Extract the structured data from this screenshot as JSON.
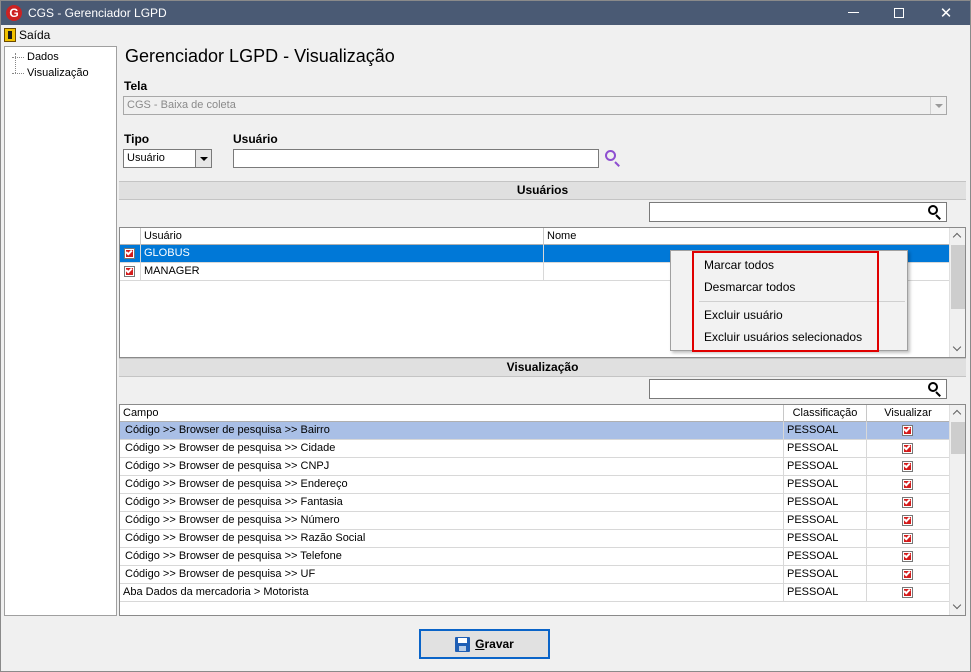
{
  "window": {
    "title": "CGS - Gerenciador LGPD",
    "logo_letter": "G",
    "controls": {
      "minimize": "minimize-icon",
      "maximize": "maximize-icon",
      "close_glyph": "✕"
    }
  },
  "menu": {
    "exit_label": "Saída"
  },
  "tree": {
    "items": [
      "Dados",
      "Visualização"
    ]
  },
  "page": {
    "title": "Gerenciador LGPD - Visualização",
    "tela_label": "Tela",
    "tela_value": "CGS - Baixa de coleta",
    "tipo_label": "Tipo",
    "tipo_value": "Usuário",
    "usuario_label": "Usuário",
    "usuario_value": ""
  },
  "users_section": {
    "header": "Usuários",
    "filter_value": "",
    "columns": [
      "Usuário",
      "Nome"
    ],
    "rows": [
      {
        "usuario": "GLOBUS",
        "nome": "",
        "checked": true,
        "selected": true
      },
      {
        "usuario": "MANAGER",
        "nome": "",
        "checked": true,
        "selected": false
      }
    ]
  },
  "context_menu": {
    "items": [
      "Marcar todos",
      "Desmarcar todos",
      "Excluir usuário",
      "Excluir usuários selecionados"
    ]
  },
  "viz_section": {
    "header": "Visualização",
    "filter_value": "",
    "columns": [
      "Campo",
      "Classificação",
      "Visualizar"
    ],
    "rows": [
      {
        "campo": "Código >> Browser de pesquisa >> Bairro",
        "classificacao": "PESSOAL",
        "visualizar": true
      },
      {
        "campo": "Código >> Browser de pesquisa >> Cidade",
        "classificacao": "PESSOAL",
        "visualizar": true
      },
      {
        "campo": "Código >> Browser de pesquisa >> CNPJ",
        "classificacao": "PESSOAL",
        "visualizar": true
      },
      {
        "campo": "Código >> Browser de pesquisa >> Endereço",
        "classificacao": "PESSOAL",
        "visualizar": true
      },
      {
        "campo": "Código >> Browser de pesquisa >> Fantasia",
        "classificacao": "PESSOAL",
        "visualizar": true
      },
      {
        "campo": "Código >> Browser de pesquisa >> Número",
        "classificacao": "PESSOAL",
        "visualizar": true
      },
      {
        "campo": "Código >> Browser de pesquisa >> Razão Social",
        "classificacao": "PESSOAL",
        "visualizar": true
      },
      {
        "campo": "Código >> Browser de pesquisa >> Telefone",
        "classificacao": "PESSOAL",
        "visualizar": true
      },
      {
        "campo": "Código >> Browser de pesquisa >> UF",
        "classificacao": "PESSOAL",
        "visualizar": true
      },
      {
        "campo": "Aba Dados da mercadoria > Motorista",
        "classificacao": "PESSOAL",
        "visualizar": true
      }
    ]
  },
  "actions": {
    "save_label": "Gravar",
    "save_icon": "floppy-disk-icon"
  },
  "colors": {
    "titlebar": "#4a5a74",
    "selection": "#0078d7",
    "row_highlight": "#a9bfe6",
    "check": "#d41c1c",
    "highlight_box": "#e00000",
    "search_accent": "#8e4fd0"
  }
}
